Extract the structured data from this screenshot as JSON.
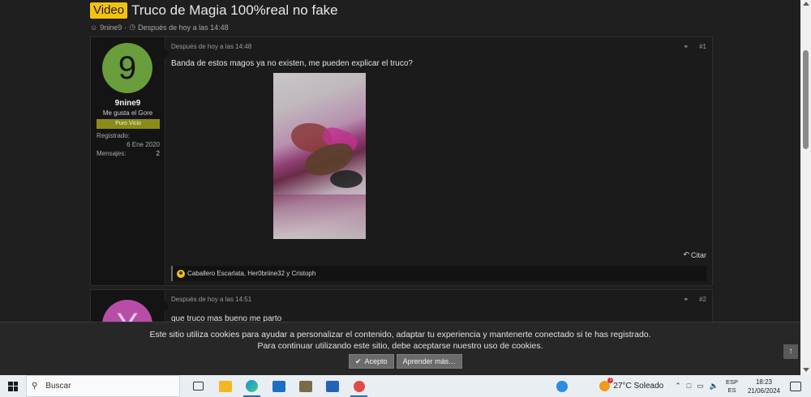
{
  "thread": {
    "prefix": "Video",
    "title": "Truco de Magia 100%real no fake",
    "author": "9nine9",
    "date": "Después de hoy a las 14:48"
  },
  "posts": [
    {
      "avatar_letter": "9",
      "avatar_color": "#6a9d3c",
      "username": "9nine9",
      "user_title": "Me gusta el Gore",
      "banner": "Puro Vicio",
      "registered_label": "Registrado:",
      "registered_value": "6 Ene 2020",
      "messages_label": "Mensajes:",
      "messages_value": "2",
      "date": "Después de hoy a las 14:48",
      "number": "#1",
      "text": "Banda de estos magos ya no existen, me pueden explicar el truco?",
      "quote_label": "Citar",
      "reactions": "Caballero Escarlata, Her0briine32 y Cristoph"
    },
    {
      "avatar_letter": "Y",
      "avatar_color": "#b84da8",
      "date": "Después de hoy a las 14:51",
      "number": "#2",
      "text": "que truco mas bueno me parto"
    }
  ],
  "cookie": {
    "line1": "Este sitio utiliza cookies para ayudar a personalizar el contenido, adaptar tu experiencia y mantenerte conectado si te has registrado.",
    "line2": "Para continuar utilizando este sitio, debe aceptarse nuestro uso de cookies.",
    "accept": "Acepto",
    "learn_more": "Aprender más…"
  },
  "taskbar": {
    "search_placeholder": "Buscar",
    "weather": "27°C  Soleado",
    "lang_top": "ESP",
    "lang_bottom": "ES",
    "time": "18:23",
    "date": "21/06/2024"
  }
}
